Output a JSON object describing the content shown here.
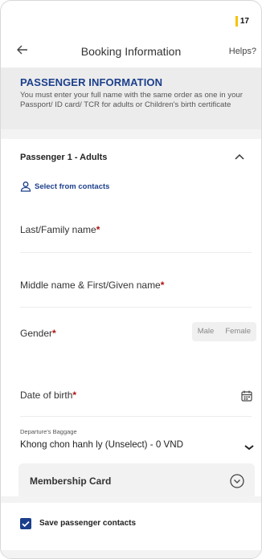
{
  "status_bar": {
    "battery": "17"
  },
  "header": {
    "title": "Booking Information",
    "help": "Helps?"
  },
  "info": {
    "title": "PASSENGER INFORMATION",
    "text": "You must enter your full name with the same order as one in your Passport/ ID card/ TCR for adults or Children's birth certificate"
  },
  "passenger": {
    "title": "Passenger 1 - Adults",
    "contacts": "Select from contacts",
    "last_name": "Last/Family name",
    "middle_name": "Middle name & First/Given name",
    "gender": "Gender",
    "gender_options": [
      "Male",
      "Female"
    ],
    "dob": "Date of birth",
    "required_mark": "*",
    "baggage_label": "Departure's Baggage",
    "baggage_value": "Khong chon hanh ly (Unselect) - 0 VND",
    "membership": "Membership Card"
  },
  "save_contacts": "Save passenger contacts",
  "colors": {
    "accent": "#1c3f8c",
    "required": "#b01010",
    "battery": "#f5c400"
  }
}
